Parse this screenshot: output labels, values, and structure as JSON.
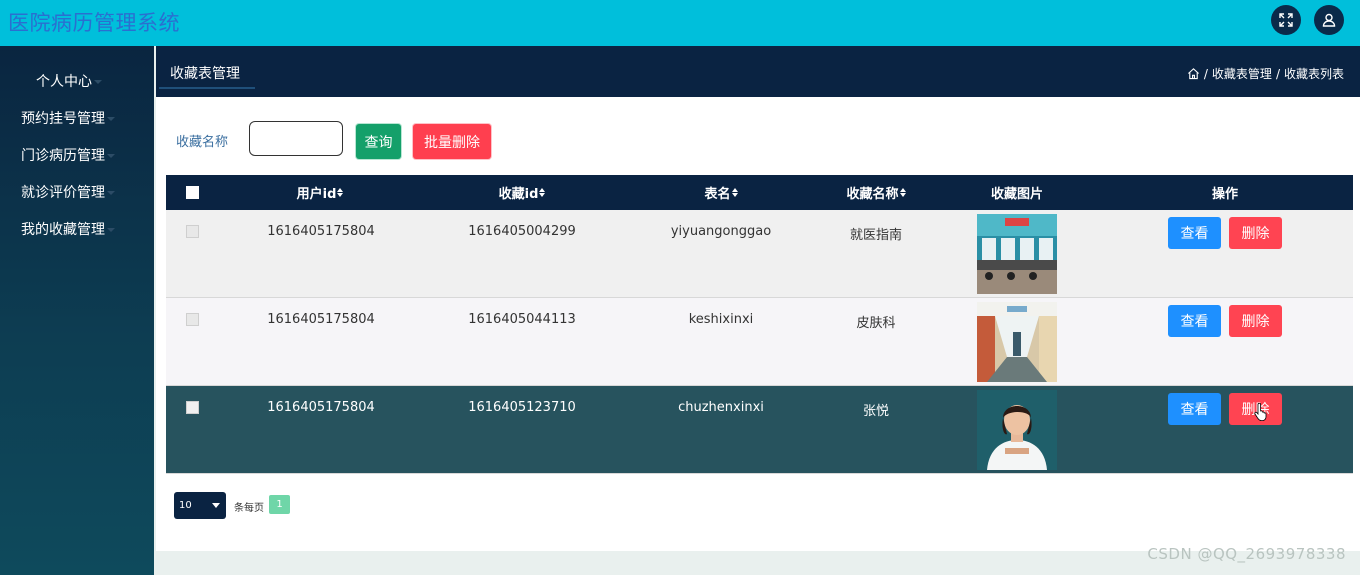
{
  "app": {
    "title": "医院病历管理系统"
  },
  "sidebar": {
    "items": [
      {
        "label": "个人中心"
      },
      {
        "label": "预约挂号管理"
      },
      {
        "label": "门诊病历管理"
      },
      {
        "label": "就诊评价管理"
      },
      {
        "label": "我的收藏管理"
      }
    ]
  },
  "header": {
    "tab": "收藏表管理",
    "breadcrumb": [
      "收藏表管理",
      "收藏表列表"
    ],
    "separator": "/"
  },
  "search": {
    "label": "收藏名称",
    "value": "",
    "query_label": "查询",
    "batch_delete_label": "批量删除"
  },
  "table": {
    "columns": [
      "用户id",
      "收藏id",
      "表名",
      "收藏名称",
      "收藏图片",
      "操作"
    ],
    "rows": [
      {
        "user_id": "1616405175804",
        "fav_id": "1616405004299",
        "table_name": "yiyuangonggao",
        "fav_name": "就医指南",
        "image": "hospital-hall",
        "view": "查看",
        "delete": "删除"
      },
      {
        "user_id": "1616405175804",
        "fav_id": "1616405044113",
        "table_name": "keshixinxi",
        "fav_name": "皮肤科",
        "image": "hospital-corridor",
        "view": "查看",
        "delete": "删除"
      },
      {
        "user_id": "1616405175804",
        "fav_id": "1616405123710",
        "table_name": "chuzhenxinxi",
        "fav_name": "张悦",
        "image": "doctor-portrait",
        "view": "查看",
        "delete": "删除"
      }
    ]
  },
  "pagination": {
    "page_size": "10",
    "per_page_label": "条每页",
    "current_page": "1"
  },
  "watermark": "CSDN @QQ_2693978338",
  "colors": {
    "topbar": "#00bfdb",
    "nav_dark": "#0a2342",
    "query_green": "#14a06a",
    "delete_red": "#ff4452",
    "view_blue": "#1e90ff",
    "selected_row": "#27535e"
  },
  "icons": {
    "fullscreen": "fullscreen-icon",
    "user": "user-icon",
    "home": "home-icon"
  }
}
